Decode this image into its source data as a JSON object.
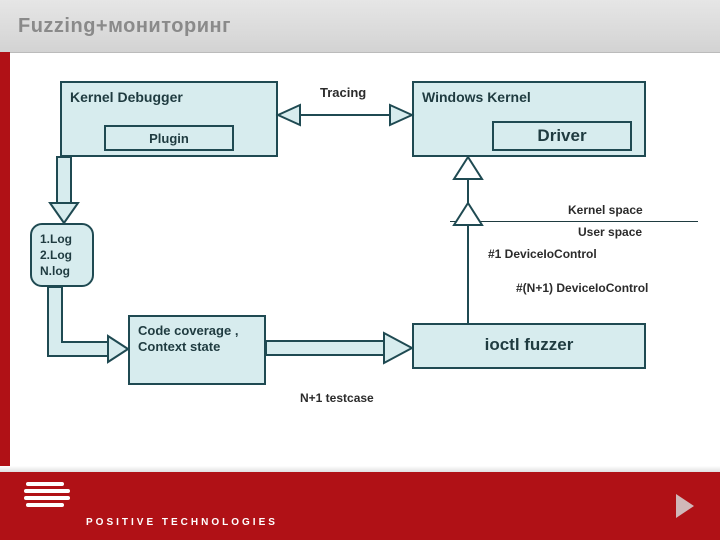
{
  "slide": {
    "title": "Fuzzing+мониторинг"
  },
  "boxes": {
    "kernel_debugger": {
      "label": "Kernel Debugger"
    },
    "plugin": {
      "label": "Plugin"
    },
    "windows_kernel": {
      "label": "Windows Kernel"
    },
    "driver": {
      "label": "Driver"
    },
    "code_coverage": {
      "label": "Code coverage , Context state"
    },
    "ioctl_fuzzer": {
      "label": "ioctl fuzzer"
    },
    "log_box": {
      "line1": "1.Log",
      "line2": "2.Log",
      "line3": "N.log"
    }
  },
  "labels": {
    "tracing": "Tracing",
    "kernel_space": "Kernel space",
    "user_space": "User space",
    "dev1": "#1 DeviceIoControl",
    "devn": "#(N+1) DeviceIoControl",
    "testcase": "N+1 testcase"
  },
  "footer": {
    "brand": "POSITIVE TECHNOLOGIES"
  },
  "chart_data": {
    "type": "diagram",
    "nodes": [
      {
        "id": "kernel_debugger",
        "label": "Kernel Debugger",
        "children": [
          {
            "id": "plugin",
            "label": "Plugin"
          }
        ]
      },
      {
        "id": "windows_kernel",
        "label": "Windows Kernel",
        "children": [
          {
            "id": "driver",
            "label": "Driver"
          }
        ]
      },
      {
        "id": "log",
        "label": "1.Log / 2.Log / N.log"
      },
      {
        "id": "code_coverage",
        "label": "Code coverage , Context state"
      },
      {
        "id": "ioctl_fuzzer",
        "label": "ioctl fuzzer"
      }
    ],
    "edges": [
      {
        "from": "kernel_debugger",
        "to": "windows_kernel",
        "label": "Tracing",
        "bidirectional": true
      },
      {
        "from": "kernel_debugger",
        "to": "log"
      },
      {
        "from": "log",
        "to": "code_coverage"
      },
      {
        "from": "code_coverage",
        "to": "ioctl_fuzzer",
        "label": "N+1 testcase"
      },
      {
        "from": "ioctl_fuzzer",
        "to": "windows_kernel",
        "label": "#1 DeviceIoControl / #(N+1) DeviceIoControl",
        "crosses": "User space → Kernel space"
      }
    ],
    "boundary": {
      "upper": "Kernel space",
      "lower": "User space"
    }
  }
}
